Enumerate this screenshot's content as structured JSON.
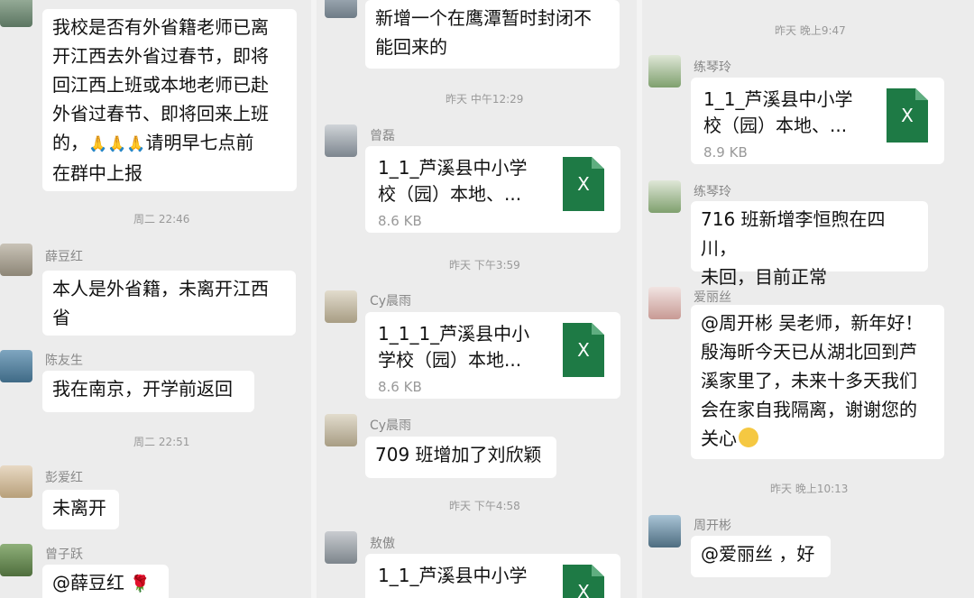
{
  "col1": {
    "msg1": {
      "lines": [
        "我校是否有外省籍老师已离",
        "开江西去外省过春节，即将",
        "回江西上班或本地老师已赴",
        "外省过春节、即将回来上班",
        "的，",
        "请明早七点前",
        "在群中上报"
      ],
      "emoji": "🙏🙏🙏"
    },
    "time1": "周二 22:46",
    "msg2": {
      "sender": "薛豆红",
      "lines": [
        "本人是外省籍，未离开江西",
        "省"
      ]
    },
    "msg3": {
      "sender": "陈友生",
      "text": "我在南京，开学前返回"
    },
    "time2": "周二 22:51",
    "msg4": {
      "sender": "彭爱红",
      "text": "未离开"
    },
    "msg5": {
      "sender": "曾子跃",
      "text": "@薛豆红",
      "emoji": "🌹"
    }
  },
  "col2": {
    "msg1": {
      "lines": [
        "新增一个在鹰潭暂时封闭不",
        "能回来的"
      ]
    },
    "time1": "昨天 中午12:29",
    "file1": {
      "sender": "曾磊",
      "title_lines": [
        "1_1_芦溪县中小学",
        "校（园）本地、..."
      ],
      "size": "8.6 KB",
      "icon": "X"
    },
    "time2": "昨天 下午3:59",
    "file2": {
      "sender": "Cy晨雨",
      "title_lines": [
        "1_1_1_芦溪县中小",
        "学校（园）本地..."
      ],
      "size": "8.6 KB",
      "icon": "X"
    },
    "msg2": {
      "sender": "Cy晨雨",
      "text": "709 班增加了刘欣颖"
    },
    "time3": "昨天 下午4:58",
    "file3": {
      "sender": "敖傲",
      "title_lines": [
        "1_1_芦溪县中小学"
      ],
      "icon": "X"
    }
  },
  "col3": {
    "time1": "昨天 晚上9:47",
    "file1": {
      "sender": "练琴玲",
      "title_lines": [
        "1_1_芦溪县中小学",
        "校（园）本地、..."
      ],
      "size": "8.9 KB",
      "icon": "X"
    },
    "msg1": {
      "sender": "练琴玲",
      "lines": [
        "716 班新增李恒煦在四川，",
        "未回，目前正常"
      ]
    },
    "msg2": {
      "sender": "爱丽丝",
      "lines": [
        "@周开彬  吴老师，新年好！",
        "殷海昕今天已从湖北回到芦",
        "溪家里了，未来十多天我们",
        "会在家自我隔离，谢谢您的",
        "关心"
      ]
    },
    "time2": "昨天 晚上10:13",
    "msg3": {
      "sender": "周开彬",
      "text": "@爱丽丝 ，好"
    }
  }
}
